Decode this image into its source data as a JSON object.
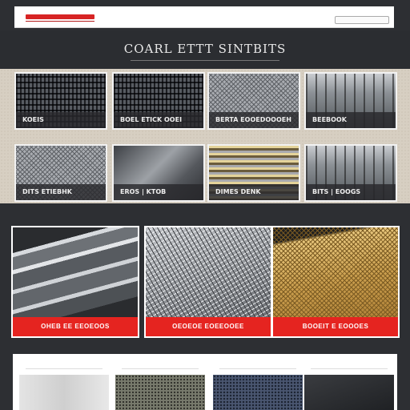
{
  "header": {
    "logo_text": "",
    "nav_text": "",
    "nav_button": ""
  },
  "hero": {
    "title": "COARL ETTT SINTBITS"
  },
  "grid1": {
    "cards": [
      {
        "caption": "KOEIS"
      },
      {
        "caption": "BOEL ETICK OOEI"
      },
      {
        "caption": "BERTA EOOEDOOOEH"
      },
      {
        "caption": "BEEBOOK"
      },
      {
        "caption": "DITS ETIEBHK"
      },
      {
        "caption": "EROS | KTOB"
      },
      {
        "caption": "DIMES DENK"
      },
      {
        "caption": "BITS | EOOGS"
      }
    ]
  },
  "featured": {
    "cards": [
      {
        "caption": "OHEB EE EEOEOOS"
      },
      {
        "caption": "OEOEOE EOEEOOEE"
      },
      {
        "caption": "BOOEIT E EOOOES"
      }
    ]
  },
  "bottom": {
    "cols": [
      {
        "label": ""
      },
      {
        "label": ""
      },
      {
        "label": ""
      },
      {
        "label": ""
      }
    ]
  },
  "colors": {
    "accent": "#e52420",
    "background": "#2d2f33"
  }
}
